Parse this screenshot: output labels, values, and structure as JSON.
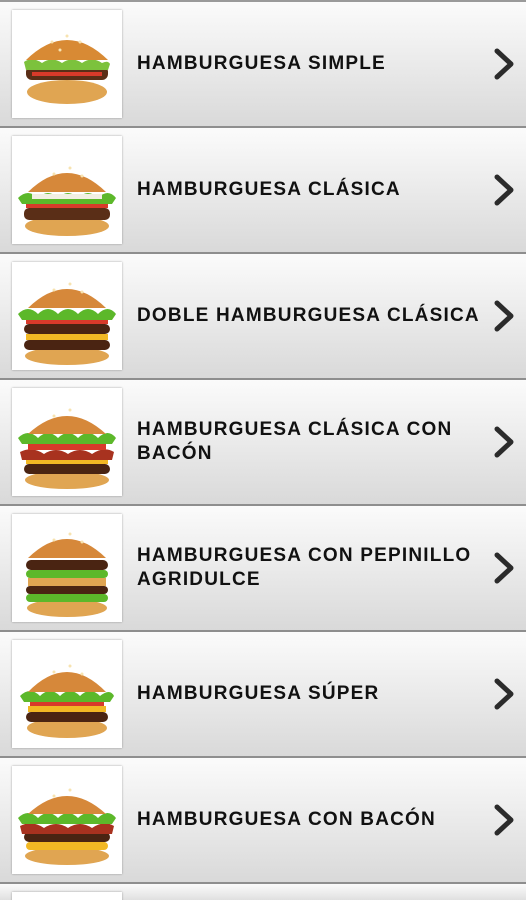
{
  "menu": {
    "items": [
      {
        "label": "HAMBURGUESA SIMPLE",
        "icon": "burger-simple-photo"
      },
      {
        "label": "HAMBURGUESA CLÁSICA",
        "icon": "burger-classic-photo"
      },
      {
        "label": "DOBLE HAMBURGUESA CLÁSICA",
        "icon": "double-burger-photo"
      },
      {
        "label": "HAMBURGUESA CLÁSICA CON\nBACÓN",
        "icon": "burger-bacon-classic-photo"
      },
      {
        "label": "HAMBURGUESA CON PEPINILLO\nAGRIDULCE",
        "icon": "burger-pickle-photo"
      },
      {
        "label": "HAMBURGUESA SÚPER",
        "icon": "burger-super-photo"
      },
      {
        "label": "HAMBURGUESA CON BACÓN",
        "icon": "burger-bacon-photo"
      }
    ],
    "chevron_icon": "chevron-right-icon"
  },
  "colors": {
    "row_top": "#fbfbfb",
    "row_bottom": "#d9d9d9",
    "separator": "#8e8e8e",
    "text": "#111111",
    "chevron": "#2b2b2b"
  }
}
